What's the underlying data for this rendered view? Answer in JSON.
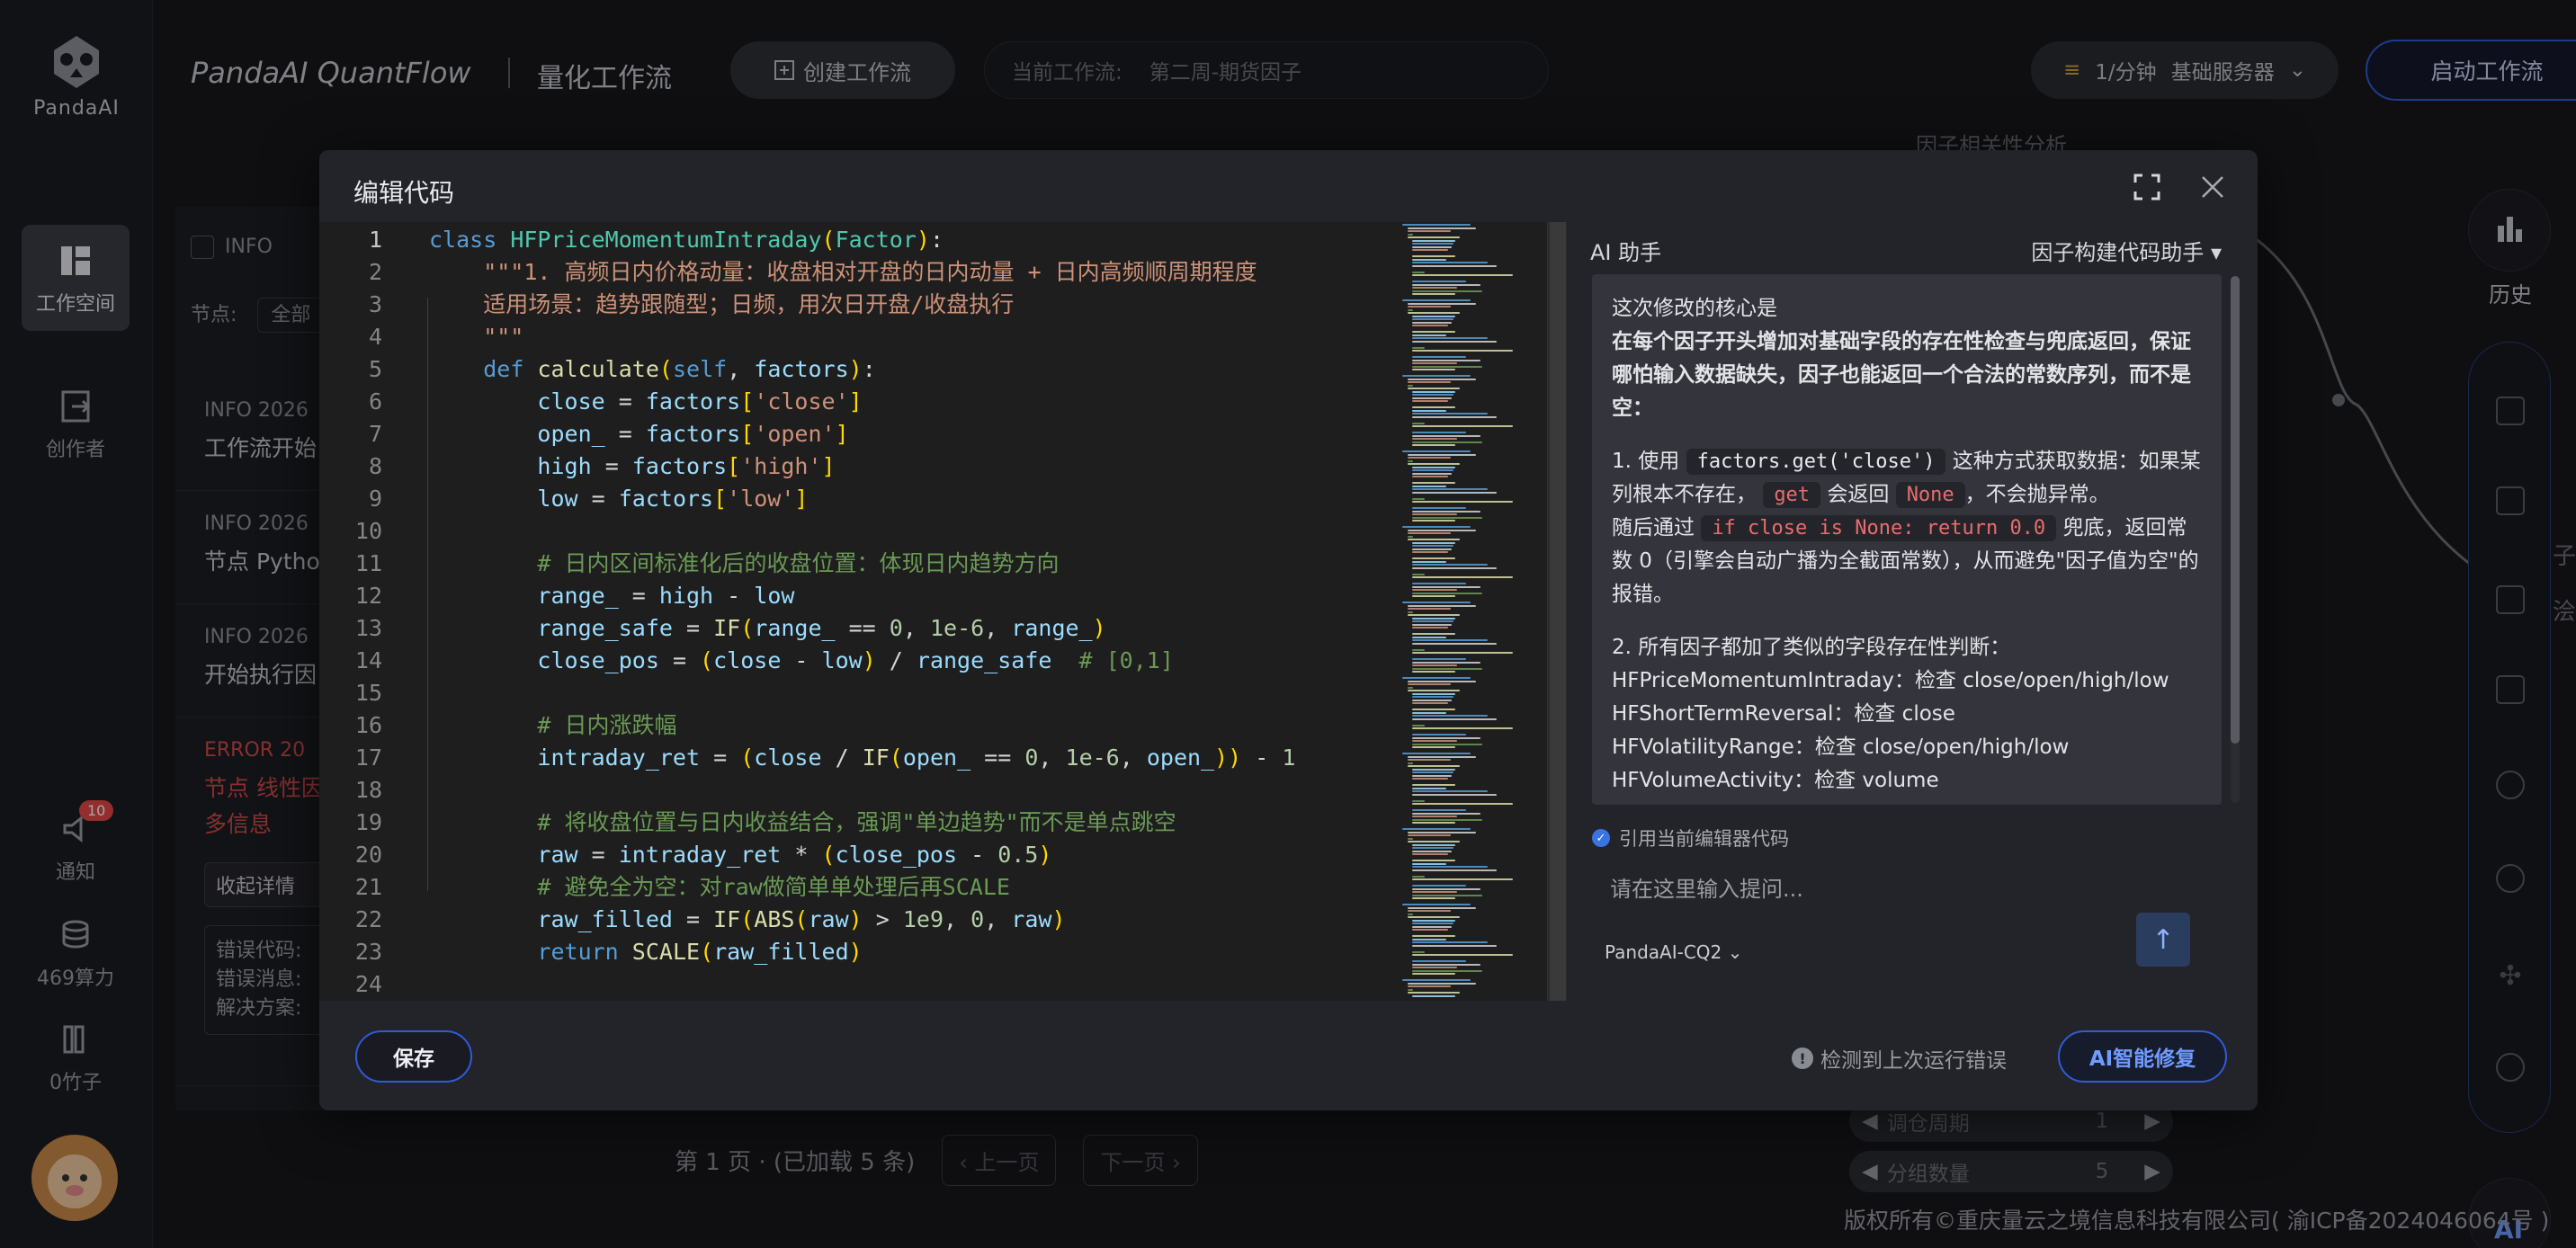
{
  "app": {
    "logo_text": "PandaAI",
    "brand": "PandaAI QuantFlow",
    "subtitle": "量化工作流"
  },
  "sidebar": {
    "items": [
      {
        "label": "工作空间",
        "icon": "workspace-icon"
      },
      {
        "label": "创作者",
        "icon": "creator-icon"
      },
      {
        "label": "通知",
        "icon": "bell-icon",
        "badge": "10"
      },
      {
        "label": "469算力",
        "icon": "compute-icon"
      },
      {
        "label": "0竹子",
        "icon": "bamboo-icon"
      }
    ]
  },
  "header": {
    "create_btn": "创建工作流",
    "current_wf_label": "当前工作流:",
    "current_wf_value": "第二周-期货因子",
    "server_price": "1/分钟",
    "server_name": "基础服务器",
    "start_btn": "启动工作流"
  },
  "logs": {
    "filter_info": "INFO",
    "filter_label": "节点:",
    "filter_value": "全部",
    "entries": [
      {
        "level": "INFO  2026",
        "msg": "工作流开始"
      },
      {
        "level": "INFO  2026",
        "msg": "节点 Pytho"
      },
      {
        "level": "INFO  2026",
        "msg": "开始执行因"
      },
      {
        "level": "ERROR  20",
        "msg": "节点 线性因",
        "msg2": "多信息"
      }
    ],
    "collapse_btn": "收起详情",
    "detail_lines": [
      "错误代码:",
      "错误消息:",
      "解决方案:"
    ],
    "pager_text": "第 1 页 · (已加载 5 条)",
    "prev_btn": "上一页",
    "next_btn": "下一页"
  },
  "canvas": {
    "node_top": "因子相关性分析",
    "history_label": "历史",
    "right_frag1": "子",
    "right_frag2": "浍",
    "param_rows": [
      {
        "label": "调仓周期",
        "value": "1"
      },
      {
        "label": "分组数量",
        "value": "5"
      }
    ],
    "ai_fab": "AI"
  },
  "copyright": "版权所有©重庆量云之境信息科技有限公司( 渝ICP备2024046064号 )",
  "modal": {
    "title": "编辑代码",
    "save_btn": "保存",
    "error_hint": "检测到上次运行错误",
    "fix_btn": "AI智能修复",
    "code_lines": [
      "class HFPriceMomentumIntraday(Factor):",
      "    \"\"\"1. 高频日内价格动量：收盘相对开盘的日内动量 + 日内高频顺周期程度",
      "    适用场景：趋势跟随型；日频，用次日开盘/收盘执行",
      "    \"\"\"",
      "    def calculate(self, factors):",
      "        close = factors['close']",
      "        open_ = factors['open']",
      "        high = factors['high']",
      "        low = factors['low']",
      "",
      "        # 日内区间标准化后的收盘位置：体现日内趋势方向",
      "        range_ = high - low",
      "        range_safe = IF(range_ == 0, 1e-6, range_)",
      "        close_pos = (close - low) / range_safe  # [0,1]",
      "",
      "        # 日内涨跌幅",
      "        intraday_ret = (close / IF(open_ == 0, 1e-6, open_)) - 1",
      "",
      "        # 将收盘位置与日内收益结合，强调\"单边趋势\"而不是单点跳空",
      "        raw = intraday_ret * (close_pos - 0.5)",
      "        # 避免全为空：对raw做简单单处理后再SCALE",
      "        raw_filled = IF(ABS(raw) > 1e9, 0, raw)",
      "        return SCALE(raw_filled)",
      ""
    ],
    "ai": {
      "title": "AI 助手",
      "assistant": "因子构建代码助手",
      "p1": "这次修改的核心是",
      "p1b": "在每个因子开头增加对基础字段的存在性检查与兜底返回，保证哪怕输入数据缺失，因子也能返回一个合法的常数序列，而不是空：",
      "s1a": "1. 使用",
      "s1code": "factors.get('close')",
      "s1b": "这种方式获取数据：如果某列根本不存在，",
      "s1code2": "get",
      "s1c": "会返回",
      "s1code3": "None",
      "s1d": "，不会抛异常。",
      "s2a": "随后通过",
      "s2code": "if close is None: return 0.0",
      "s2b": "兜底，返回常数 0（引擎会自动广播为全截面常数），从而避免\"因子值为空\"的报错。",
      "s3": "2. 所有因子都加了类似的字段存在性判断：",
      "l1": "HFPriceMomentumIntraday：检查 close/open/high/low",
      "l2": "HFShortTermReversal：检查 close",
      "l3": "HFVolatilityRange：检查 close/open/high/low",
      "l4": "HFVolumeActivity：检查 volume",
      "ref_label": "引用当前编辑器代码",
      "input_placeholder": "请在这里输入提问...",
      "model": "PandaAI-CQ2"
    }
  },
  "colors": {
    "accent": "#2f5bd8",
    "error": "#e04848",
    "bg": "#17181c",
    "modal": "#23242a",
    "editor": "#1e1e1e"
  }
}
